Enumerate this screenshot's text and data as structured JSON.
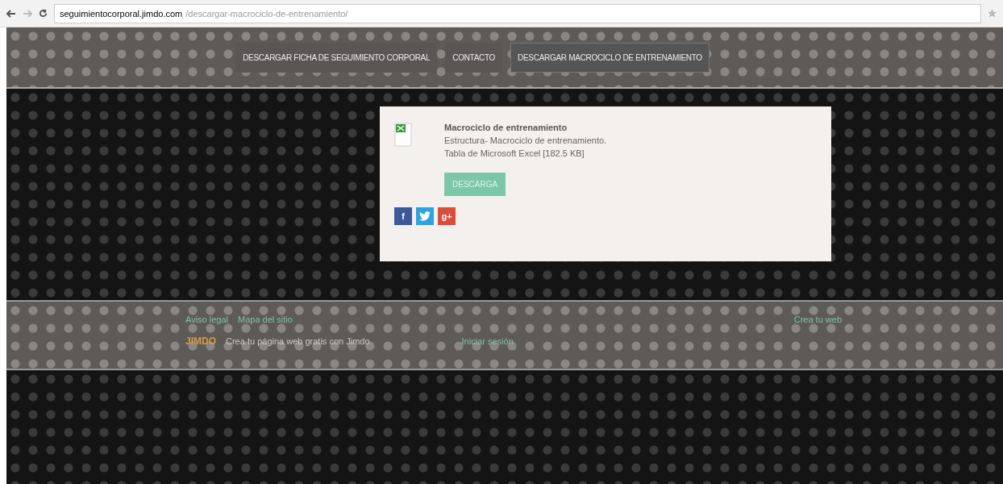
{
  "browser": {
    "url_host": "seguimientocorporal.jimdo.com",
    "url_path": "/descargar-macrociclo-de-entrenamiento/"
  },
  "nav": [
    {
      "label": "DESCARGAR FICHA DE SEGUIMIENTO CORPORAL",
      "selected": false
    },
    {
      "label": "CONTACTO",
      "selected": false
    },
    {
      "label": "DESCARGAR MACROCICLO DE ENTRENAMIENTO",
      "selected": true
    }
  ],
  "download": {
    "title": "Macrociclo de entrenamiento",
    "description": "Estructura- Macrociclo de entrenamiento.",
    "file_info": "Tabla de Microsoft Excel [182.5 KB]",
    "button": "DESCARGA"
  },
  "share": [
    {
      "kind": "facebook",
      "label": "f"
    },
    {
      "kind": "twitter"
    },
    {
      "kind": "google",
      "label": "g+"
    }
  ],
  "footer": {
    "links": [
      "Aviso legal",
      "Mapa del sitio"
    ],
    "logo": "JIMDO",
    "tagline": "Crea tu página web gratis con Jimdo",
    "login": "Iniciar sesión",
    "edit": "Crea tu web"
  }
}
